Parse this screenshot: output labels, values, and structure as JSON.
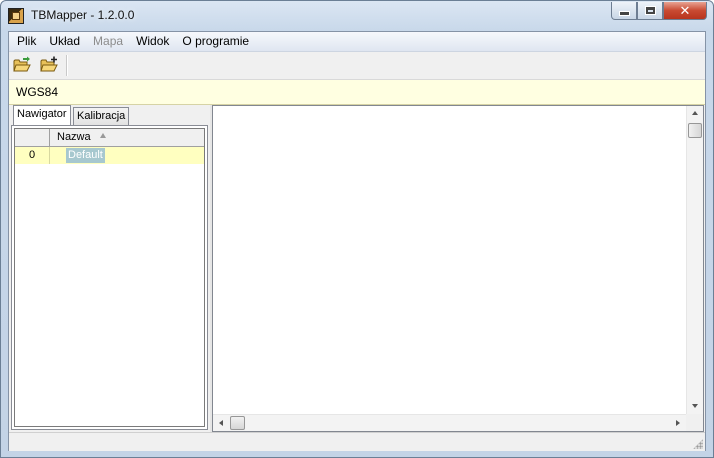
{
  "window": {
    "title": "TBMapper - 1.2.0.0",
    "minimize_glyph": "",
    "maximize_glyph": "",
    "close_glyph": "✕"
  },
  "menu": {
    "items": [
      {
        "label": "Plik",
        "enabled": true
      },
      {
        "label": "Układ",
        "enabled": true
      },
      {
        "label": "Mapa",
        "enabled": false
      },
      {
        "label": "Widok",
        "enabled": true
      },
      {
        "label": "O programie",
        "enabled": true
      }
    ]
  },
  "toolbar": {
    "buttons": [
      {
        "icon": "open-folder-icon"
      },
      {
        "icon": "new-folder-icon"
      }
    ]
  },
  "infobar": {
    "coordinate_system": "WGS84"
  },
  "left_panel": {
    "tabs": [
      {
        "label": "Nawigator",
        "active": true
      },
      {
        "label": "Kalibracja",
        "active": false
      }
    ],
    "grid": {
      "columns": [
        "",
        "Nazwa"
      ],
      "rows": [
        {
          "index": "0",
          "name": "Default"
        }
      ]
    }
  },
  "colors": {
    "info_bar": "#ffffe1",
    "selected_row": "#ffffc0",
    "cell_highlight": "#a7c8cf",
    "close_button": "#c94a32"
  }
}
